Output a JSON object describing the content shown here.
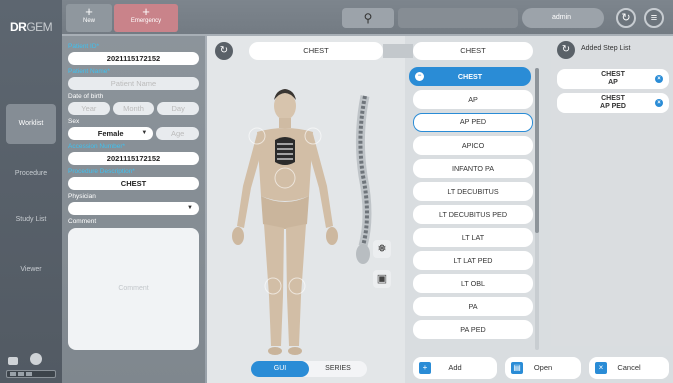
{
  "brand": {
    "logo_dr": "DR",
    "logo_gem": "GEM"
  },
  "nav": {
    "items": [
      {
        "label": "Worklist",
        "active": true
      },
      {
        "label": "Procedure",
        "active": false
      },
      {
        "label": "Study List",
        "active": false
      },
      {
        "label": "Viewer",
        "active": false
      }
    ]
  },
  "topbar": {
    "new_label": "New",
    "emergency_label": "Emergency",
    "user": "admin"
  },
  "form": {
    "patient_id_label": "Patient ID*",
    "patient_id_value": "2021115172152",
    "patient_name_label": "Patient Name*",
    "patient_name_placeholder": "Patient Name",
    "dob_label": "Date of birth",
    "dob_year_placeholder": "Year",
    "dob_month_placeholder": "Month",
    "dob_day_placeholder": "Day",
    "sex_label": "Sex",
    "sex_value": "Female",
    "age_placeholder": "Age",
    "accession_label": "Accession Number*",
    "accession_value": "2021115172152",
    "procedure_label": "Procedure Description*",
    "procedure_value": "CHEST",
    "physician_label": "Physician",
    "comment_label": "Comment",
    "comment_placeholder": "Comment"
  },
  "anatomy": {
    "selected_region_left": "CHEST",
    "selected_region_right": "CHEST",
    "toggle_gui": "GUI",
    "toggle_series": "SERIES"
  },
  "exams": {
    "header": "CHEST",
    "items": [
      "AP",
      "AP PED",
      "APICO",
      "INFANTO PA",
      "LT DECUBITUS",
      "LT DECUBITUS PED",
      "LT LAT",
      "LT LAT PED",
      "LT OBL",
      "PA",
      "PA PED"
    ],
    "selected": "AP PED"
  },
  "steps": {
    "title": "Added Step List",
    "items": [
      {
        "line1": "CHEST",
        "line2": "AP"
      },
      {
        "line1": "CHEST",
        "line2": "AP PED"
      }
    ]
  },
  "actions": {
    "add": "Add",
    "open": "Open",
    "cancel": "Cancel"
  },
  "colors": {
    "accent": "#2a8cd6",
    "required_label": "#3ec1f0",
    "emergency": "#c9838a"
  }
}
